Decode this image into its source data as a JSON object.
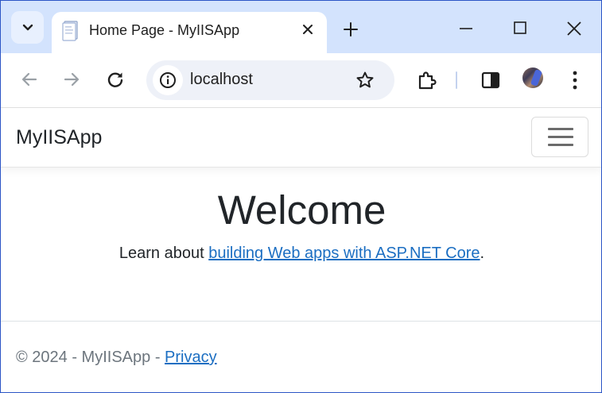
{
  "browser": {
    "tab": {
      "title": "Home Page - MyIISApp"
    },
    "url": "localhost",
    "icons": {
      "tab_search": "chevron-down-icon",
      "favicon": "page-icon",
      "tab_close": "close-icon",
      "new_tab": "plus-icon",
      "minimize": "minimize-icon",
      "maximize": "maximize-icon",
      "close_window": "close-icon",
      "back": "arrow-left-icon",
      "forward": "arrow-right-icon",
      "reload": "reload-icon",
      "site_info": "info-icon",
      "bookmark": "star-icon",
      "extensions": "puzzle-icon",
      "side_panel": "side-panel-icon",
      "profile": "avatar",
      "menu": "kebab-menu-icon"
    }
  },
  "navbar": {
    "brand": "MyIISApp",
    "toggler_icon": "hamburger-menu-icon"
  },
  "main": {
    "heading": "Welcome",
    "text_before": "Learn about ",
    "link_text": "building Web apps with ASP.NET Core",
    "text_after": "."
  },
  "footer": {
    "text": "© 2024 - MyIISApp - ",
    "privacy_link": "Privacy"
  },
  "colors": {
    "tabstrip_bg": "#d3e3fd",
    "omnibox_bg": "#eef1f8",
    "link": "#1b6ec2",
    "text": "#212529",
    "muted": "#6c757d",
    "window_border": "#2b55c6"
  }
}
